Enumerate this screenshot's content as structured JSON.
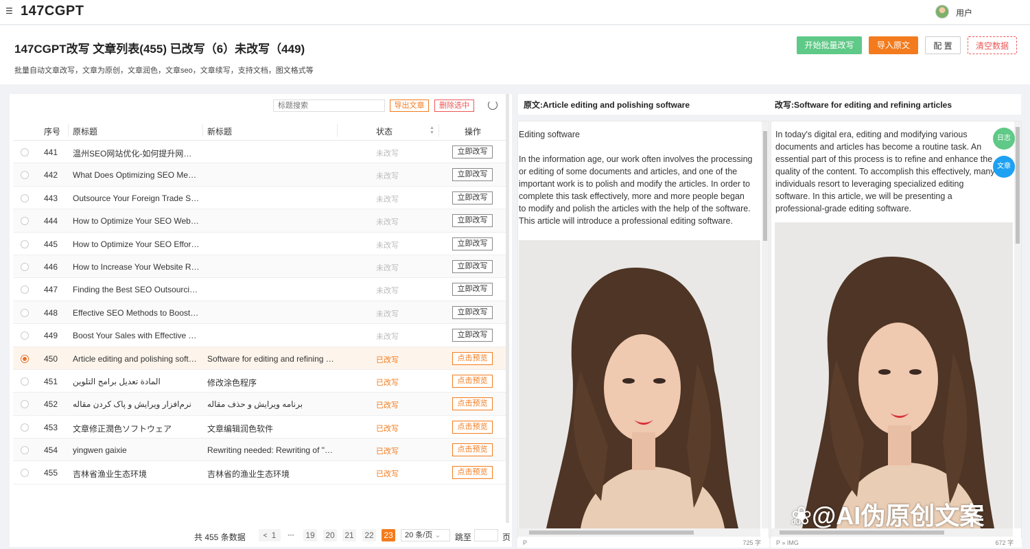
{
  "app": {
    "brand": "147CGPT",
    "menu_icon": "menu-icon",
    "user": "用户"
  },
  "header": {
    "title": "147CGPT改写 文章列表(455) 已改写（6）未改写（449)",
    "subtitle": "批量自动文章改写，文章为原创，文章润色，文章seo，文章续写，支持文档，图文格式等",
    "buttons": {
      "start": "开始批量改写",
      "import": "导入原文",
      "config": "配 置",
      "clear": "清空数据"
    }
  },
  "toolbar": {
    "search_placeholder": "标题搜索",
    "export": "导出文章",
    "delete": "删除选中",
    "refresh_icon": "refresh-icon"
  },
  "table": {
    "columns": [
      "序号",
      "原标题",
      "新标题",
      "状态",
      "操作"
    ],
    "rows": [
      {
        "num": "441",
        "orig": "温州SEO网站优化-如何提升网站流量及排名",
        "new": "",
        "status": "未改写",
        "action": "立即改写",
        "done": false,
        "selected": false
      },
      {
        "num": "442",
        "orig": "What Does Optimizing SEO Mean?",
        "new": "",
        "status": "未改写",
        "action": "立即改写",
        "done": false,
        "selected": false
      },
      {
        "num": "443",
        "orig": "Outsource Your Foreign Trade SEO Services",
        "new": "",
        "status": "未改写",
        "action": "立即改写",
        "done": false,
        "selected": false
      },
      {
        "num": "444",
        "orig": "How to Optimize Your SEO Website",
        "new": "",
        "status": "未改写",
        "action": "立即改写",
        "done": false,
        "selected": false
      },
      {
        "num": "445",
        "orig": "How to Optimize Your SEO Efforts for Success",
        "new": "",
        "status": "未改写",
        "action": "立即改写",
        "done": false,
        "selected": false
      },
      {
        "num": "446",
        "orig": "How to Increase Your Website Ranking",
        "new": "",
        "status": "未改写",
        "action": "立即改写",
        "done": false,
        "selected": false
      },
      {
        "num": "447",
        "orig": "Finding the Best SEO Outsourcing Company",
        "new": "",
        "status": "未改写",
        "action": "立即改写",
        "done": false,
        "selected": false
      },
      {
        "num": "448",
        "orig": "Effective SEO Methods to Boost Your Rankings",
        "new": "",
        "status": "未改写",
        "action": "立即改写",
        "done": false,
        "selected": false
      },
      {
        "num": "449",
        "orig": "Boost Your Sales with Effective Taobao SEO",
        "new": "",
        "status": "未改写",
        "action": "立即改写",
        "done": false,
        "selected": false
      },
      {
        "num": "450",
        "orig": "Article editing and polishing software",
        "new": "Software for editing and refining articles",
        "status": "已改写",
        "action": "点击预览",
        "done": true,
        "selected": true
      },
      {
        "num": "451",
        "orig": "المادة تعديل برامج التلوين",
        "new": "修改涂色程序",
        "status": "已改写",
        "action": "点击预览",
        "done": true,
        "selected": false
      },
      {
        "num": "452",
        "orig": "نرم‌افزار ویرایش و پاک کردن مقاله",
        "new": "برنامه ویرایش و حذف مقاله",
        "status": "已改写",
        "action": "点击预览",
        "done": true,
        "selected": false
      },
      {
        "num": "453",
        "orig": "文章修正潤色ソフトウェア",
        "new": "文章编辑润色软件",
        "status": "已改写",
        "action": "点击预览",
        "done": true,
        "selected": false
      },
      {
        "num": "454",
        "orig": "yingwen gaixie",
        "new": "Rewriting needed: Rewriting of \"yingwen gaixie\"",
        "status": "已改写",
        "action": "点击预览",
        "done": true,
        "selected": false
      },
      {
        "num": "455",
        "orig": "吉林省渔业生态环境",
        "new": "吉林省的渔业生态环境",
        "status": "已改写",
        "action": "点击预览",
        "done": true,
        "selected": false
      }
    ]
  },
  "pagination": {
    "total": "共 455 条数据",
    "prev": "<",
    "pages": [
      "1",
      "•••",
      "19",
      "20",
      "21",
      "22",
      "23"
    ],
    "active": "23",
    "page_size": "20 条/页",
    "jump": "跳至",
    "page_suffix": "页"
  },
  "original": {
    "heading": "原文:Article editing and polishing software",
    "paragraph1": "Editing software",
    "paragraph2": "In the information age, our work often involves the processing or editing of some documents and articles, and one of the important work is to polish and modify the articles. In order to complete this task effectively, more and more people began to modify and polish the articles with the help of the software. This article will introduce a professional editing software.",
    "status_path": "P",
    "word_count": "725 字"
  },
  "rewritten": {
    "heading": "改写:Software for editing and refining articles",
    "paragraph1": "In today's digital era, editing and modifying various documents and articles has become a routine task. An essential part of this process is to refine and enhance the quality of the content. To accomplish this effectively, many individuals resort to leveraging specialized editing software. In this article, we will be presenting a professional-grade editing software.",
    "status_path": "P » IMG",
    "word_count": "672 字"
  },
  "floating": {
    "log": "日志",
    "article": "文章"
  },
  "watermark": {
    "text": "@AI伪原创文案",
    "logo": "du"
  },
  "colors": {
    "accent": "#f37b1d",
    "start_button": "#5fc987",
    "clear_button": "#ee5555",
    "log_button": "#5fc987",
    "article_button": "#1ea1f2",
    "done_status": "#f37b1d",
    "pending_status": "#bbbbbb"
  }
}
